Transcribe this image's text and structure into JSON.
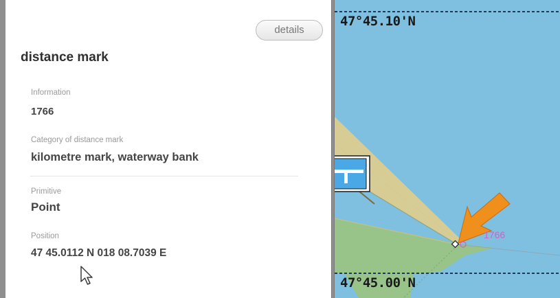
{
  "panel": {
    "title": "distance mark",
    "details_label": "details",
    "fields": [
      {
        "label": "Information",
        "value": "1766"
      },
      {
        "label": "Category of distance mark",
        "value": "kilometre mark, waterway bank"
      },
      {
        "label": "Primitive",
        "value": "Point"
      },
      {
        "label": "Position",
        "value": "47 45.0112 N  018 08.7039 E"
      }
    ]
  },
  "chart": {
    "lat_top": "47°45.10'N",
    "lat_bottom": "47°45.00'N",
    "mark_label": "1766",
    "colors": {
      "water": "#7fc0e0",
      "land": "#d6cc94",
      "shallow": "#98c48a",
      "pointer_arrow": "#f0901c",
      "mark_text": "#d35fc7",
      "sign_fill": "#4aa8e6"
    },
    "icons": [
      "pointer-arrow-icon",
      "distance-mark-symbol-icon",
      "traffic-sign-icon",
      "mouse-cursor-icon"
    ]
  }
}
